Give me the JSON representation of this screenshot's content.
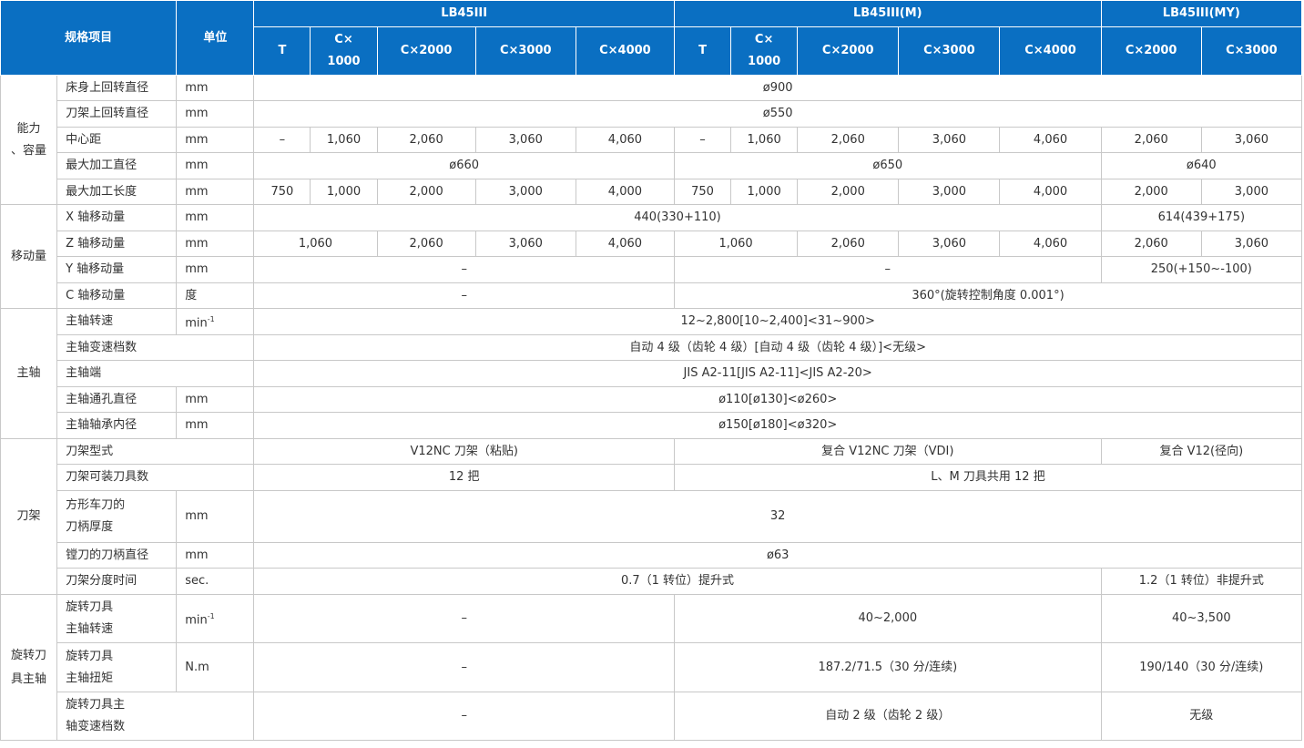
{
  "header": {
    "spec_item": "规格项目",
    "unit": "单位",
    "models": [
      "LB45III",
      "LB45III(M)",
      "LB45III(MY)"
    ],
    "sub": [
      "T",
      "C×\n1000",
      "C×2000",
      "C×3000",
      "C×4000",
      "T",
      "C×\n1000",
      "C×2000",
      "C×3000",
      "C×4000",
      "C×2000",
      "C×3000"
    ]
  },
  "groups": {
    "capacity": "能力\n、容量",
    "travel": "移动量",
    "spindle": "主轴",
    "turret": "刀架",
    "rotary": "旋转刀\n具主轴"
  },
  "rows": {
    "swing_bed": {
      "name": "床身上回转直径",
      "unit": "mm",
      "value": "ø900"
    },
    "swing_carriage": {
      "name": "刀架上回转直径",
      "unit": "mm",
      "value": "ø550"
    },
    "center_distance": {
      "name": "中心距",
      "unit": "mm",
      "values": [
        "–",
        "1,060",
        "2,060",
        "3,060",
        "4,060",
        "–",
        "1,060",
        "2,060",
        "3,060",
        "4,060",
        "2,060",
        "3,060"
      ]
    },
    "max_dia": {
      "name": "最大加工直径",
      "unit": "mm",
      "values": [
        "ø660",
        "ø650",
        "ø640"
      ]
    },
    "max_len": {
      "name": "最大加工长度",
      "unit": "mm",
      "values": [
        "750",
        "1,000",
        "2,000",
        "3,000",
        "4,000",
        "750",
        "1,000",
        "2,000",
        "3,000",
        "4,000",
        "2,000",
        "3,000"
      ]
    },
    "x_travel": {
      "name": "X 轴移动量",
      "unit": "mm",
      "values": [
        "440(330+110)",
        "614(439+175)"
      ]
    },
    "z_travel": {
      "name": "Z 轴移动量",
      "unit": "mm",
      "values": [
        "1,060",
        "2,060",
        "3,060",
        "4,060",
        "1,060",
        "2,060",
        "3,060",
        "4,060",
        "2,060",
        "3,060"
      ]
    },
    "y_travel": {
      "name": "Y 轴移动量",
      "unit": "mm",
      "values": [
        "–",
        "–",
        "250(+150~-100)"
      ]
    },
    "c_travel": {
      "name": "C 轴移动量",
      "unit": "度",
      "values": [
        "–",
        "360°(旋转控制角度 0.001°)"
      ]
    },
    "spindle_speed": {
      "name": "主轴转速",
      "unit": "min",
      "unit_sup": "-1",
      "value": "12~2,800[10~2,400]<31~900>"
    },
    "spindle_steps": {
      "name": "主轴变速档数",
      "value": "自动 4 级（齿轮 4 级）[自动 4 级（齿轮 4 级）]<无级>"
    },
    "spindle_nose": {
      "name": "主轴端",
      "value": "JIS A2-11[JIS A2-11]<JIS A2-20>"
    },
    "spindle_bore": {
      "name": "主轴通孔直径",
      "unit": "mm",
      "value": "ø110[ø130]<ø260>"
    },
    "bearing_dia": {
      "name": "主轴轴承内径",
      "unit": "mm",
      "value": "ø150[ø180]<ø320>"
    },
    "turret_type": {
      "name": "刀架型式",
      "values": [
        "V12NC 刀架（粘贴)",
        "复合 V12NC 刀架（VDI)",
        "复合 V12(径向)"
      ]
    },
    "tool_count": {
      "name": "刀架可装刀具数",
      "values": [
        "12 把",
        "L、M 刀具共用 12 把"
      ]
    },
    "shank": {
      "name": "方形车刀的\n刀柄厚度",
      "unit": "mm",
      "value": "32"
    },
    "boring": {
      "name": "镗刀的刀柄直径",
      "unit": "mm",
      "value": "ø63"
    },
    "index_time": {
      "name": "刀架分度时间",
      "unit": "sec.",
      "values": [
        "0.7（1 转位）提升式",
        "1.2（1 转位）非提升式"
      ]
    },
    "rot_speed": {
      "name": "旋转刀具\n主轴转速",
      "unit": "min",
      "unit_sup": "-1",
      "values": [
        "–",
        "40~2,000",
        "40~3,500"
      ]
    },
    "rot_torque": {
      "name": "旋转刀具\n主轴扭矩",
      "unit": "N.m",
      "values": [
        "–",
        "187.2/71.5（30 分/连续)",
        "190/140（30 分/连续)"
      ]
    },
    "rot_steps": {
      "name": "旋转刀具主\n轴变速档数",
      "values": [
        "–",
        "自动 2 级（齿轮 2 级）",
        "无级"
      ]
    }
  },
  "colors": {
    "header_bg": "#0a6fc2",
    "header_text": "#ffffff",
    "border": "#c8c8c8",
    "text": "#333333"
  }
}
